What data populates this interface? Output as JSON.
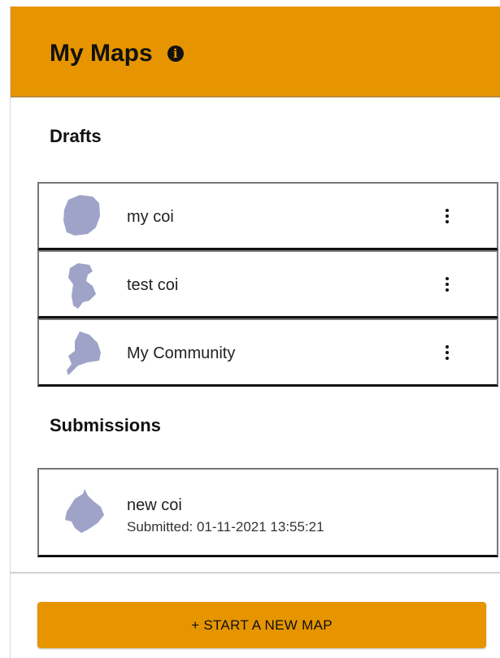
{
  "header": {
    "title": "My Maps",
    "info_icon": "info-icon",
    "color": "#e69500"
  },
  "drafts": {
    "heading": "Drafts",
    "items": [
      {
        "label": "my coi",
        "icon": "map-shape-icon",
        "menu_icon": "kebab-menu-icon"
      },
      {
        "label": "test coi",
        "icon": "map-shape-icon",
        "menu_icon": "kebab-menu-icon"
      },
      {
        "label": "My Community",
        "icon": "map-shape-icon",
        "menu_icon": "kebab-menu-icon"
      }
    ]
  },
  "submissions": {
    "heading": "Submissions",
    "items": [
      {
        "label": "new coi",
        "status": "Submitted: 01-11-2021 13:55:21",
        "icon": "map-shape-icon"
      }
    ]
  },
  "actions": {
    "start_new_map": "+ START A NEW MAP"
  },
  "colors": {
    "accent": "#e69500",
    "shape_fill": "#a0a3c8"
  }
}
